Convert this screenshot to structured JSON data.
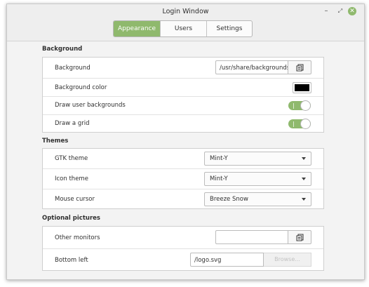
{
  "window": {
    "title": "Login Window",
    "controls": {
      "minimize": "–",
      "maximize": "⤢",
      "close": "✕"
    }
  },
  "tabs": [
    {
      "label": "Appearance",
      "active": true
    },
    {
      "label": "Users",
      "active": false
    },
    {
      "label": "Settings",
      "active": false
    }
  ],
  "background_section": {
    "title": "Background",
    "rows": {
      "background": {
        "label": "Background",
        "value": "/usr/share/backgrounds/",
        "button_icon": "file-chooser-icon"
      },
      "background_color": {
        "label": "Background color",
        "color": "#000000"
      },
      "draw_user_backgrounds": {
        "label": "Draw user backgrounds",
        "on": true
      },
      "draw_grid": {
        "label": "Draw a grid",
        "on": true
      }
    }
  },
  "themes_section": {
    "title": "Themes",
    "rows": {
      "gtk_theme": {
        "label": "GTK theme",
        "value": "Mint-Y"
      },
      "icon_theme": {
        "label": "Icon theme",
        "value": "Mint-Y"
      },
      "mouse_cursor": {
        "label": "Mouse cursor",
        "value": "Breeze Snow"
      }
    }
  },
  "pictures_section": {
    "title": "Optional pictures",
    "rows": {
      "other_monitors": {
        "label": "Other monitors",
        "value": "",
        "button_icon": "file-chooser-icon"
      },
      "bottom_left": {
        "label": "Bottom left",
        "value": "/logo.svg",
        "button_label": "Browse..."
      }
    }
  },
  "colors": {
    "accent": "#8fb96d",
    "window_bg": "#f3f3f3"
  }
}
